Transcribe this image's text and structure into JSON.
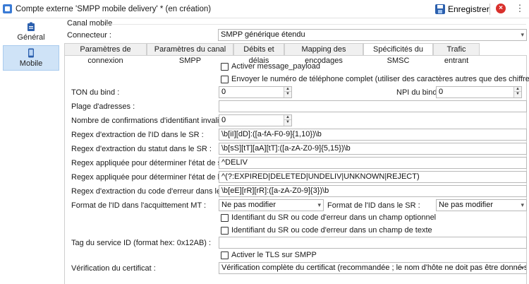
{
  "window": {
    "title": "Compte externe 'SMPP mobile delivery' * (en création)",
    "save_label": "Enregistrer"
  },
  "sidebar": {
    "items": [
      {
        "label": "Général",
        "icon": "clipboard-icon"
      },
      {
        "label": "Mobile",
        "icon": "phone-icon"
      }
    ]
  },
  "section": {
    "title": "Canal mobile",
    "connector_label": "Connecteur :",
    "connector_value": "SMPP générique étendu"
  },
  "tabs": [
    {
      "label": "Paramètres de connexion"
    },
    {
      "label": "Paramètres du canal SMPP"
    },
    {
      "label": "Débits et délais"
    },
    {
      "label": "Mapping des encodages"
    },
    {
      "label": "Spécificités du SMSC"
    },
    {
      "label": "Trafic entrant"
    }
  ],
  "form": {
    "activer_payload": "Activer message_payload",
    "envoyer_numero": "Envoyer le numéro de téléphone complet (utiliser des caractères autres que des chiffres)",
    "ton_label": "TON du bind :",
    "ton_value": "0",
    "npi_label": "NPI du bind :",
    "npi_value": "0",
    "plage_label": "Plage d'adresses :",
    "plage_value": "",
    "nb_confirm_label": "Nombre de confirmations d'identifiant invalides :",
    "nb_confirm_value": "0",
    "regex_id_label": "Regex d'extraction de l'ID dans le SR :",
    "regex_id_value": "\\b[iI][dD]:([a-fA-F0-9]{1,10})\\b",
    "regex_statut_label": "Regex d'extraction du statut dans le SR :",
    "regex_statut_value": "\\b[sS][tT][aA][tT]:([a-zA-Z0-9]{5,15})\\b",
    "regex_succes_label": "Regex appliquée pour déterminer l'état de succès :",
    "regex_succes_value": "^DELIV",
    "regex_erreur_label": "Regex appliquée pour déterminer l'état de l'erreur :",
    "regex_erreur_value": "^(?:EXPIRED|DELETED|UNDELIV|UNKNOWN|REJECT)",
    "regex_code_label": "Regex d'extraction du code d'erreur dans le SR :",
    "regex_code_value": "\\b[eE][rR][rR]:([a-zA-Z0-9]{3})\\b",
    "format_mt_label": "Format de l'ID dans l'acquittement MT :",
    "format_mt_value": "Ne pas modifier",
    "format_sr_label": "Format de l'ID dans le SR :",
    "format_sr_value": "Ne pas modifier",
    "ident_optionnel": "Identifiant du SR ou code d'erreur dans un champ optionnel",
    "ident_texte": "Identifiant du SR ou code d'erreur dans un champ de texte",
    "tag_label": "Tag du service ID (format hex: 0x12AB) :",
    "tag_value": "",
    "tls": "Activer le TLS sur SMPP",
    "verif_label": "Vérification du certificat :",
    "verif_value": "Vérification complète du certificat (recommandée ; le nom d'hôte ne doit pas être donné sous forme..."
  }
}
